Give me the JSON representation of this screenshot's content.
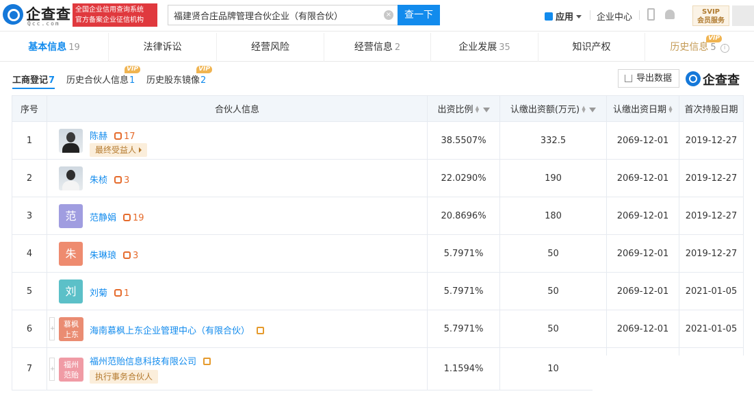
{
  "logo": {
    "brand": "企查查",
    "sub": "Qcc.com"
  },
  "badge": {
    "line1": "全国企业信用查询系统",
    "line2": "官方备案企业征信机构"
  },
  "search": {
    "value": "福建贤合庄品牌管理合伙企业（有限合伙）",
    "button": "查一下"
  },
  "header": {
    "apps": "应用",
    "center": "企业中心",
    "svip_title": "SVIP",
    "svip_sub": "会员服务"
  },
  "nav_tabs": [
    {
      "label": "基本信息",
      "count": "19"
    },
    {
      "label": "法律诉讼",
      "count": ""
    },
    {
      "label": "经营风险",
      "count": ""
    },
    {
      "label": "经营信息",
      "count": "2"
    },
    {
      "label": "企业发展",
      "count": "35"
    },
    {
      "label": "知识产权",
      "count": ""
    },
    {
      "label": "历史信息",
      "count": "5"
    }
  ],
  "vip_label": "VIP",
  "sub_tabs": [
    {
      "label": "工商登记",
      "count": "7"
    },
    {
      "label": "历史合伙人信息",
      "count": "1"
    },
    {
      "label": "历史股东镜像",
      "count": "2"
    }
  ],
  "export_label": "导出数据",
  "brand2": "企查查",
  "table": {
    "headers": [
      "序号",
      "合伙人信息",
      "出资比例",
      "认缴出资额(万元)",
      "认缴出资日期",
      "首次持股日期"
    ],
    "rows": [
      {
        "no": "1",
        "name": "陈赫",
        "rel": "17",
        "tag": "最终受益人",
        "ratio": "38.5507%",
        "amount": "332.5",
        "sub_date": "2069-12-01",
        "first_date": "2019-12-27"
      },
      {
        "no": "2",
        "name": "朱桢",
        "rel": "3",
        "ratio": "22.0290%",
        "amount": "190",
        "sub_date": "2069-12-01",
        "first_date": "2019-12-27"
      },
      {
        "no": "3",
        "name": "范静娟",
        "rel": "19",
        "avatar": "范",
        "avatar_color": "#a09de0",
        "ratio": "20.8696%",
        "amount": "180",
        "sub_date": "2069-12-01",
        "first_date": "2019-12-27"
      },
      {
        "no": "4",
        "name": "朱琳琅",
        "rel": "3",
        "avatar": "朱",
        "avatar_color": "#ee8b6f",
        "ratio": "5.7971%",
        "amount": "50",
        "sub_date": "2069-12-01",
        "first_date": "2019-12-27"
      },
      {
        "no": "5",
        "name": "刘菊",
        "rel": "1",
        "avatar": "刘",
        "avatar_color": "#5cc0c8",
        "ratio": "5.7971%",
        "amount": "50",
        "sub_date": "2069-12-01",
        "first_date": "2021-01-05"
      },
      {
        "no": "6",
        "name": "海南慕枫上东企业管理中心（有限合伙）",
        "avatar_l1": "慕枫",
        "avatar_l2": "上东",
        "avatar_color": "#ea8c72",
        "ratio": "5.7971%",
        "amount": "50",
        "sub_date": "2069-12-01",
        "first_date": "2021-01-05"
      },
      {
        "no": "7",
        "name": "福州范贻信息科技有限公司",
        "tag": "执行事务合伙人",
        "avatar_l1": "福州",
        "avatar_l2": "范贻",
        "avatar_color": "#f09ba5",
        "ratio": "1.1594%",
        "amount": "10",
        "sub_date": "",
        "first_date": ""
      }
    ]
  }
}
